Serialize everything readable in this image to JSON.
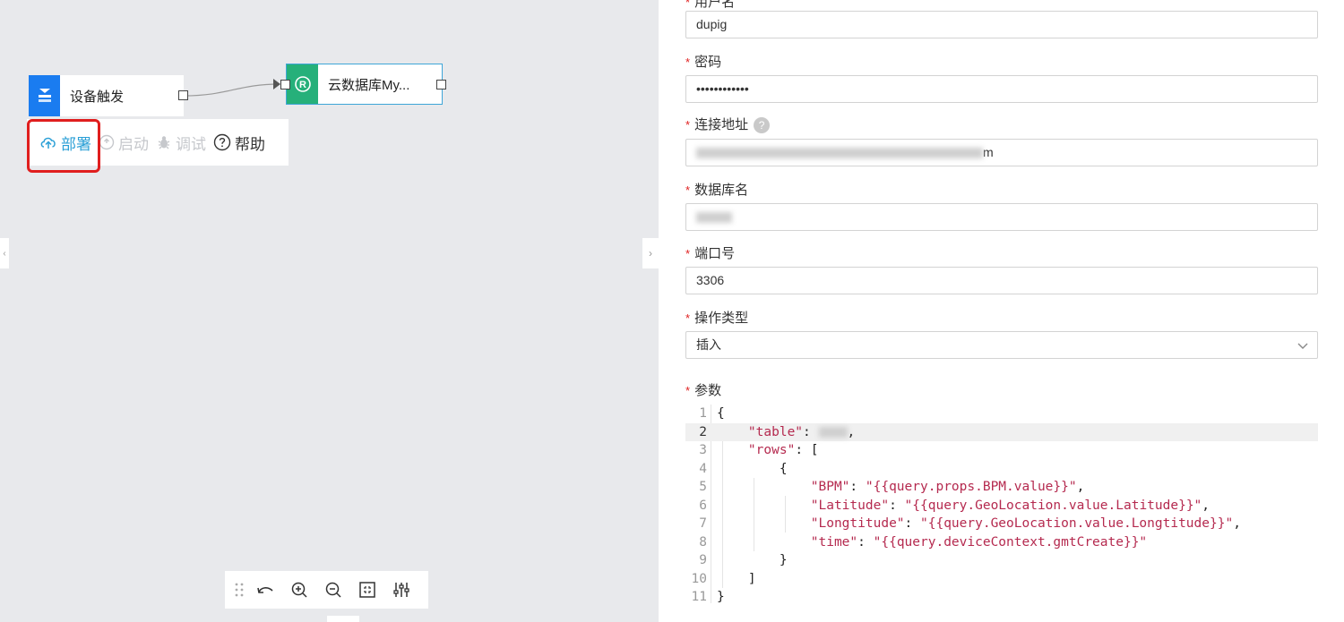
{
  "flow": {
    "trigger_node": {
      "label": "设备触发"
    },
    "db_node": {
      "label": "云数据库My...",
      "badge": "R"
    }
  },
  "toolbar": {
    "deploy": "部署",
    "start": "启动",
    "debug": "调试",
    "help": "帮助"
  },
  "form": {
    "username": {
      "label": "用户名",
      "value": "dupig"
    },
    "password": {
      "label": "密码",
      "value": "••••••••••••"
    },
    "connection": {
      "label": "连接地址",
      "value_visible_suffix": "m",
      "help": "?"
    },
    "database": {
      "label": "数据库名"
    },
    "port": {
      "label": "端口号",
      "value": "3306"
    },
    "operation": {
      "label": "操作类型",
      "value": "插入"
    },
    "params": {
      "label": "参数",
      "lines": [
        {
          "n": "1",
          "text": "{"
        },
        {
          "n": "2",
          "key": "\"table\"",
          "sep": ": ",
          "tail": ","
        },
        {
          "n": "3",
          "key": "\"rows\"",
          "sep": ": ["
        },
        {
          "n": "4",
          "text": "{"
        },
        {
          "n": "5",
          "key": "\"BPM\"",
          "sep": ": ",
          "val": "\"{{query.props.BPM.value}}\"",
          "tail": ","
        },
        {
          "n": "6",
          "key": "\"Latitude\"",
          "sep": ": ",
          "val": "\"{{query.GeoLocation.value.Latitude}}\"",
          "tail": ","
        },
        {
          "n": "7",
          "key": "\"Longtitude\"",
          "sep": ": ",
          "val": "\"{{query.GeoLocation.value.Longtitude}}\"",
          "tail": ","
        },
        {
          "n": "8",
          "key": "\"time\"",
          "sep": ": ",
          "val": "\"{{query.deviceContext.gmtCreate}}\""
        },
        {
          "n": "9",
          "text": "}"
        },
        {
          "n": "10",
          "text": "]"
        },
        {
          "n": "11",
          "text": "}"
        }
      ]
    }
  },
  "colors": {
    "accent": "#2a9fd6",
    "highlight": "#e01e1e",
    "required": "#e02020",
    "string": "#b52a4f"
  }
}
